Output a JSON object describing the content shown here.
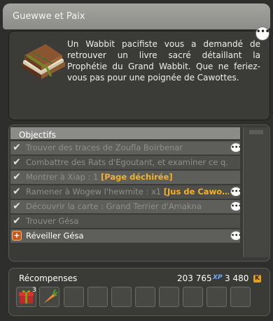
{
  "window": {
    "title": "Guewwe et Paix"
  },
  "quest": {
    "icon": "book-icon",
    "description": "Un Wabbit pacifiste vous a demandé de retrouver un livre sacré détaillant la Prophétie du Grand Wabbit. Que ne feriez-vous pas pour une poignée de Cawottes."
  },
  "objectives": {
    "header": "Objectifs",
    "rows": [
      {
        "status": "done",
        "text": "Trouver des traces de Zoufla Boirbenar",
        "highlight": "",
        "has_bubble": true
      },
      {
        "status": "done",
        "text": "Combattre des Rats d'Egoutant, et examiner ce q…",
        "highlight": "",
        "has_bubble": false
      },
      {
        "status": "done",
        "text": "Montrer à Xiap : 1 ",
        "highlight": "[Page déchirée]",
        "has_bubble": false
      },
      {
        "status": "done",
        "text": "Ramener à Wogew l'hewmite : x1 ",
        "highlight": "[Jus de Cawo…",
        "has_bubble": true
      },
      {
        "status": "done",
        "text": "Découvrir la carte : Grand Terrier d'Amakna",
        "highlight": "",
        "has_bubble": true
      },
      {
        "status": "done",
        "text": "Trouver Gésa",
        "highlight": "",
        "has_bubble": false
      },
      {
        "status": "active",
        "text": "Réveiller Gésa",
        "highlight": "",
        "has_bubble": true
      }
    ],
    "bubble_glyph": "•••"
  },
  "rewards": {
    "label": "Récompenses",
    "xp_value": "203 765",
    "xp_tag": "XP",
    "kamas_value": "3 480",
    "kamas_tag": "K",
    "items": [
      {
        "icon": "gift-box-icon",
        "quantity": ""
      },
      {
        "icon": "carrot-icon",
        "quantity": "3"
      }
    ]
  },
  "colors": {
    "highlight": "#f5b12a",
    "title_bar": "#9a9a96",
    "panel": "#2e2e2c",
    "xp": "#6fa8ff",
    "kamas": "#e0a020"
  }
}
